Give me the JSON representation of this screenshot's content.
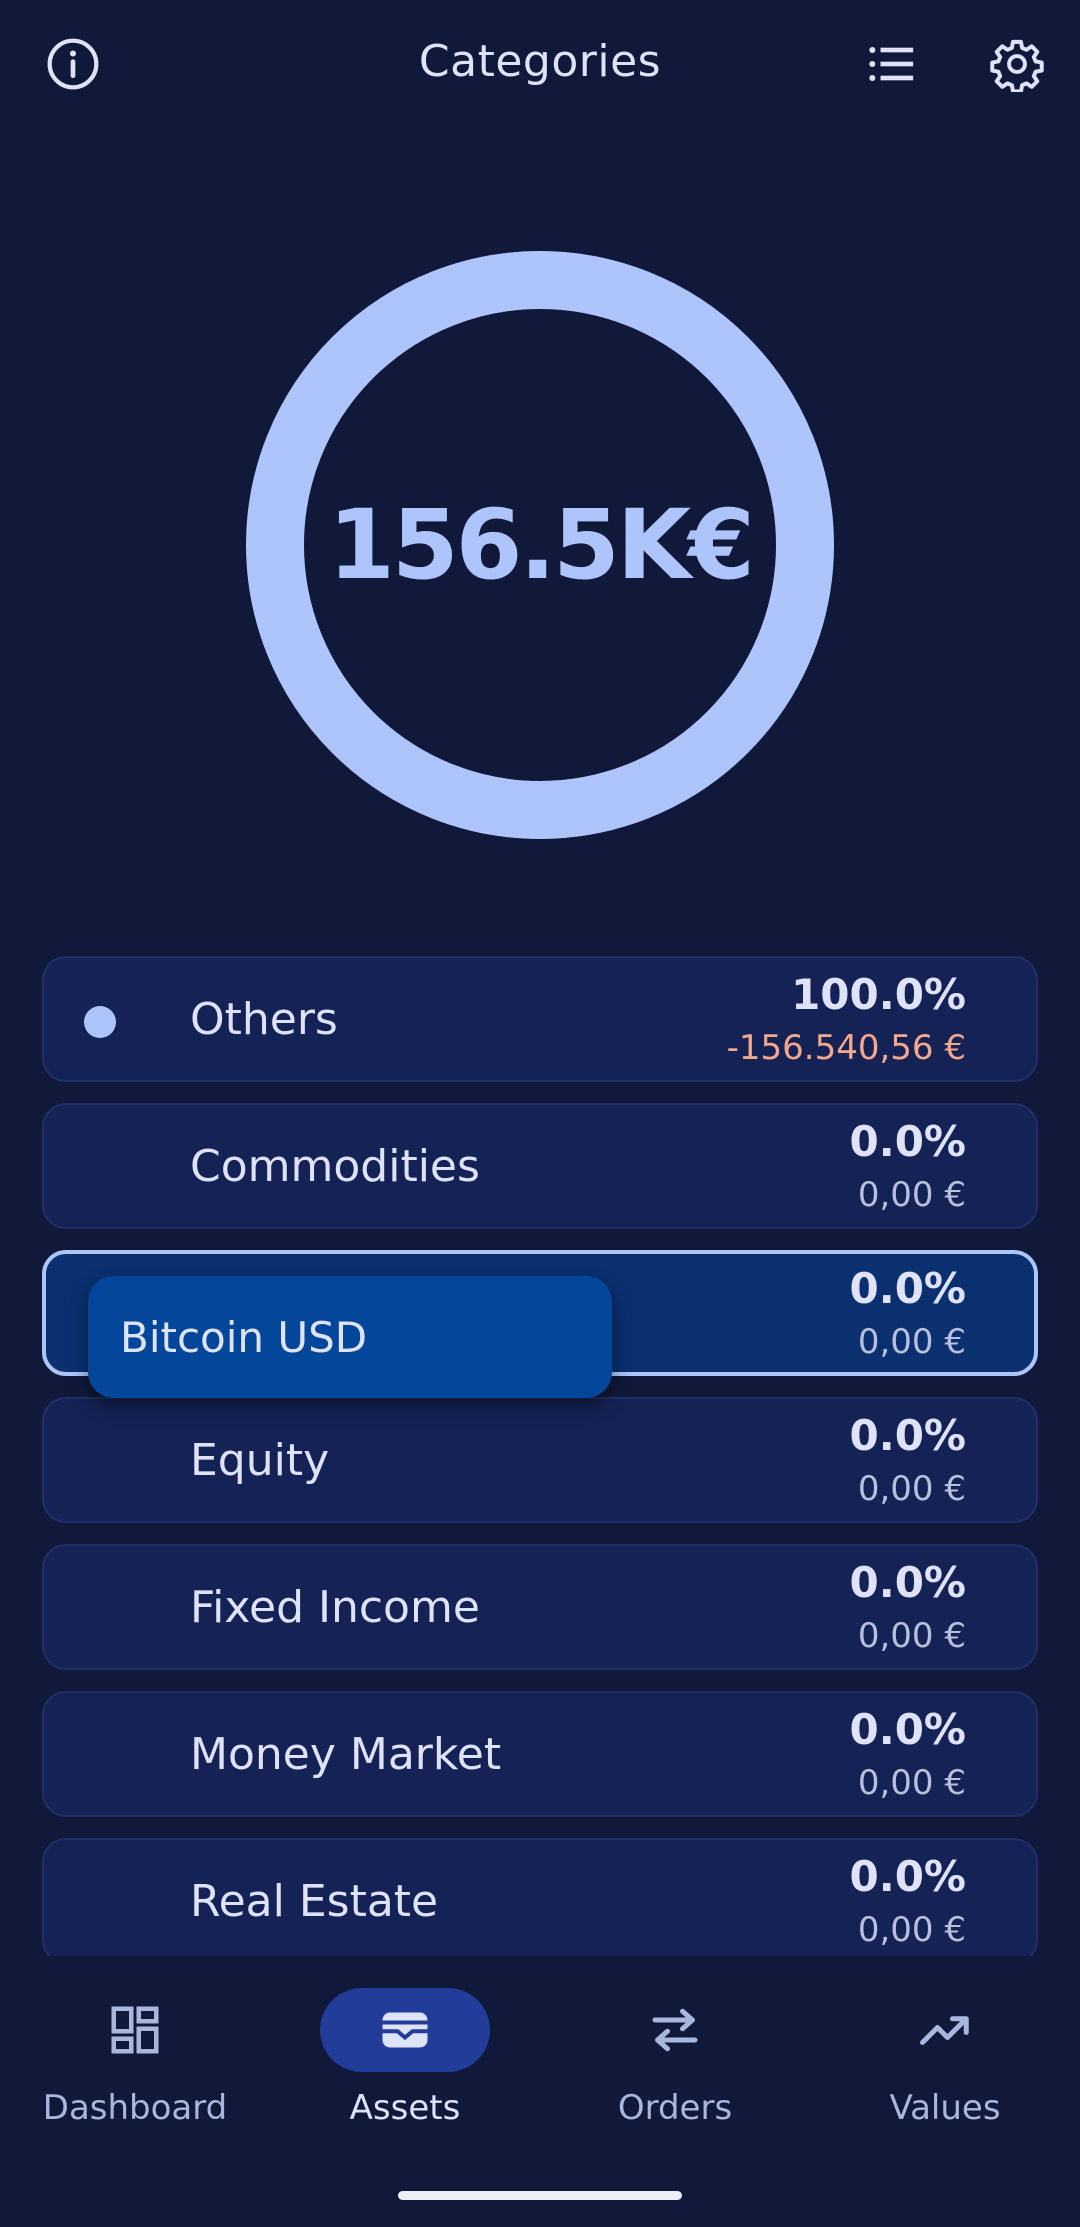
{
  "header": {
    "title": "Categories",
    "info_icon": "info-icon",
    "list_icon": "list-icon",
    "settings_icon": "gear-icon"
  },
  "donut": {
    "total_label": "156.5K€",
    "ring_color": "#aec5fb"
  },
  "categories": [
    {
      "name": "Others",
      "percent": "100.0%",
      "amount": "-156.540,56 €",
      "color": "#aec5fb",
      "negative": true
    },
    {
      "name": "Commodities",
      "percent": "0.0%",
      "amount": "0,00 €"
    },
    {
      "name": "",
      "percent": "0.0%",
      "amount": "0,00 €",
      "selected": true
    },
    {
      "name": "Equity",
      "percent": "0.0%",
      "amount": "0,00 €"
    },
    {
      "name": "Fixed Income",
      "percent": "0.0%",
      "amount": "0,00 €"
    },
    {
      "name": "Money Market",
      "percent": "0.0%",
      "amount": "0,00 €"
    },
    {
      "name": "Real Estate",
      "percent": "0.0%",
      "amount": "0,00 €"
    }
  ],
  "tooltip": {
    "text": "Bitcoin USD"
  },
  "nav": [
    {
      "label": "Dashboard",
      "icon": "dashboard-icon"
    },
    {
      "label": "Assets",
      "icon": "wallet-icon",
      "active": true
    },
    {
      "label": "Orders",
      "icon": "swap-arrows-icon"
    },
    {
      "label": "Values",
      "icon": "trending-up-icon"
    }
  ],
  "colors": {
    "background": "#101939",
    "card": "#152255",
    "selected_card": "#0a3070",
    "accent": "#aec5fb",
    "negative": "#f3a88c",
    "tooltip": "#03469a",
    "nav_active": "#213c99"
  }
}
